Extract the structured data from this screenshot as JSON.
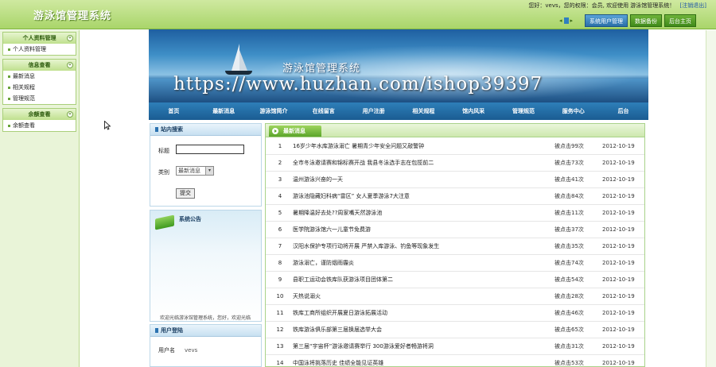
{
  "app": {
    "title": "游泳馆管理系统",
    "welcome": "您好：vevs，您的权限：会员, 欢迎使用 游泳馆管理系统！",
    "logout": "[注销退出]",
    "top_tabs": [
      "系统用户管理",
      "数据备份",
      "后台主页"
    ]
  },
  "sidebar": {
    "groups": [
      {
        "title": "个人资料管理",
        "items": [
          "个人资料管理"
        ]
      },
      {
        "title": "信息查看",
        "items": [
          "最新消息",
          "相关规程",
          "管理规范"
        ]
      },
      {
        "title": "余额查看",
        "items": [
          "余额查看"
        ]
      }
    ]
  },
  "banner": {
    "title": "游泳馆管理系统",
    "watermark": "https://www.huzhan.com/ishop39397"
  },
  "main_nav": [
    "首页",
    "最新消息",
    "游泳馆简介",
    "在线留言",
    "用户注册",
    "相关规程",
    "馆内风采",
    "管理规范",
    "服务中心",
    "后台"
  ],
  "search": {
    "header": "站内搜索",
    "title_label": "标题",
    "title_value": "",
    "type_label": "类别",
    "type_selected": "最新消息",
    "submit_label": "提交"
  },
  "notice": {
    "header": "系统公告",
    "scroll_text": "欢迎光临游泳馆管理系统，您好，欢迎光临"
  },
  "login": {
    "header": "用户登陆",
    "user_label": "用户名",
    "user_value": "vevs"
  },
  "news": {
    "tab_label": "最新消息",
    "rows": [
      {
        "num": "1",
        "title": "16岁少年水库游泳溺亡 暑期青少年安全问题又敲警钟",
        "clicks": "被点击99次",
        "date": "2012-10-19"
      },
      {
        "num": "2",
        "title": "全市冬泳邀请赛和锦标赛开战 我县冬泳选手志在包揽前二",
        "clicks": "被点击73次",
        "date": "2012-10-19"
      },
      {
        "num": "3",
        "title": "温州游泳兴奋的一天",
        "clicks": "被点击41次",
        "date": "2012-10-19"
      },
      {
        "num": "4",
        "title": "游泳池隐藏妇科病“雷区” 女人夏季游泳7大注意",
        "clicks": "被点击84次",
        "date": "2012-10-19"
      },
      {
        "num": "5",
        "title": "暑期降温好去处??周家嘴天然游泳池",
        "clicks": "被点击11次",
        "date": "2012-10-19"
      },
      {
        "num": "6",
        "title": "医学院游泳馆六一儿童节免费游",
        "clicks": "被点击37次",
        "date": "2012-10-19"
      },
      {
        "num": "7",
        "title": "汉阳水保护专项行动将开展 严禁入库游泳、钓鱼等现象发生",
        "clicks": "被点击35次",
        "date": "2012-10-19"
      },
      {
        "num": "8",
        "title": "游泳溺亡，谨防烟雨霾炎",
        "clicks": "被点击74次",
        "date": "2012-10-19"
      },
      {
        "num": "9",
        "title": "县职工运动会铁库队获游泳项目团体第二",
        "clicks": "被点击54次",
        "date": "2012-10-19"
      },
      {
        "num": "10",
        "title": "天热说溺火",
        "clicks": "被点击28次",
        "date": "2012-10-19"
      },
      {
        "num": "11",
        "title": "铁库工商所组织开展夏日游泳拓展活动",
        "clicks": "被点击46次",
        "date": "2012-10-19"
      },
      {
        "num": "12",
        "title": "铁库游泳俱乐部第三届换届选举大会",
        "clicks": "被点击65次",
        "date": "2012-10-19"
      },
      {
        "num": "13",
        "title": "第三届“宇宙杯”游泳邀请赛举行 300游泳爱好者畅游将洞",
        "clicks": "被点击31次",
        "date": "2012-10-19"
      },
      {
        "num": "14",
        "title": "中国泳将挑落历史 佳绩全能见证英雄",
        "clicks": "被点击53次",
        "date": "2012-10-19"
      }
    ]
  },
  "colors": {
    "topbar": "#a9d56a",
    "nav_blue": "#1a5c92",
    "news_green": "#5ba52b"
  }
}
